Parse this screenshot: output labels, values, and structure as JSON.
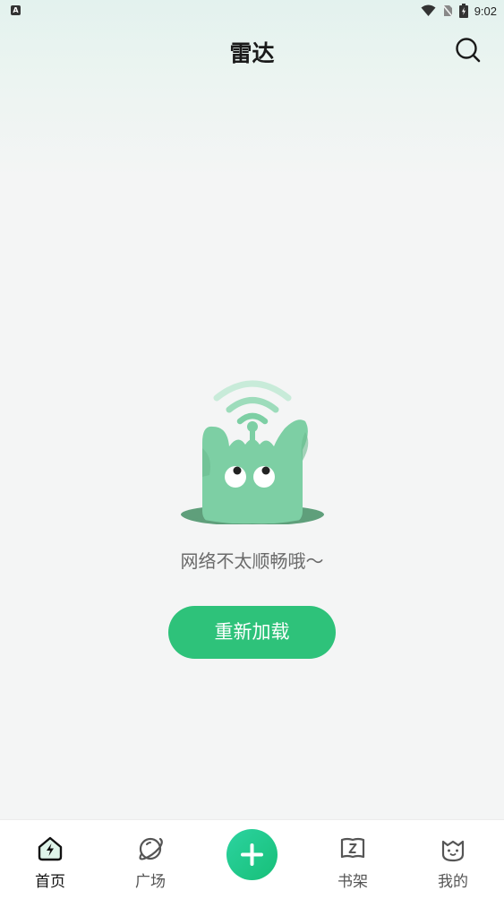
{
  "status_bar": {
    "app_icon_letter": "A",
    "time": "9:02"
  },
  "header": {
    "title": "雷达"
  },
  "empty_state": {
    "message": "网络不太顺畅哦～",
    "reload_label": "重新加载"
  },
  "tabbar": {
    "tabs": [
      {
        "label": "首页",
        "icon": "home-lightning-icon",
        "active": true
      },
      {
        "label": "广场",
        "icon": "planet-icon",
        "active": false
      },
      {
        "label": "",
        "icon": "plus-icon",
        "active": false
      },
      {
        "label": "书架",
        "icon": "bookshelf-z-icon",
        "active": false
      },
      {
        "label": "我的",
        "icon": "cat-face-icon",
        "active": false
      }
    ]
  },
  "colors": {
    "accent": "#2ec27a",
    "mascot": "#7dcfa4",
    "background": "#f4f5f5"
  }
}
